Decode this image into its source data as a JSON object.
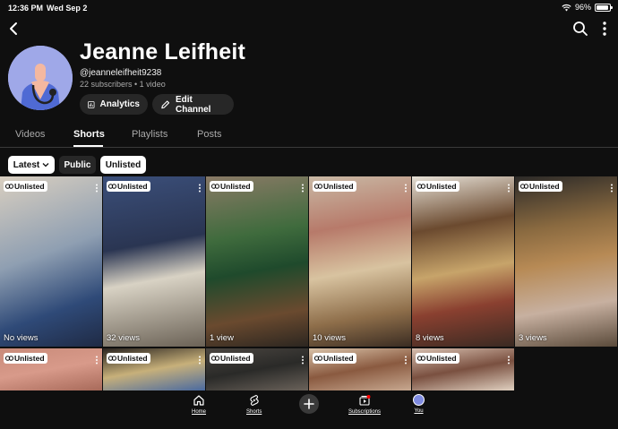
{
  "status_bar": {
    "time": "12:36 PM",
    "date": "Wed Sep 2",
    "battery": "96%",
    "battery_level": 0.96
  },
  "channel": {
    "name": "Jeanne Leifheit",
    "handle": "@jeanneleifheit9238",
    "meta": "22 subscribers • 1 video",
    "analytics_label": "Analytics",
    "edit_label": "Edit Channel"
  },
  "tabs": [
    {
      "label": "Videos"
    },
    {
      "label": "Shorts"
    },
    {
      "label": "Playlists"
    },
    {
      "label": "Posts"
    }
  ],
  "filters": {
    "latest": "Latest",
    "public": "Public",
    "unlisted": "Unlisted"
  },
  "shorts": [
    {
      "badge": "Unlisted",
      "views": "No views"
    },
    {
      "badge": "Unlisted",
      "views": "32 views"
    },
    {
      "badge": "Unlisted",
      "views": "1 view"
    },
    {
      "badge": "Unlisted",
      "views": "10 views"
    },
    {
      "badge": "Unlisted",
      "views": "8 views"
    },
    {
      "badge": "Unlisted",
      "views": "3 views"
    },
    {
      "badge": "Unlisted",
      "views": ""
    },
    {
      "badge": "Unlisted",
      "views": ""
    },
    {
      "badge": "Unlisted",
      "views": ""
    },
    {
      "badge": "Unlisted",
      "views": ""
    },
    {
      "badge": "Unlisted",
      "views": ""
    }
  ],
  "bottom_nav": {
    "home": "Home",
    "shorts": "Shorts",
    "subscriptions": "Subscriptions",
    "you": "You"
  },
  "colors": {
    "background": "#0f0f0f",
    "chip_dark": "#272727",
    "avatar_bg": "#9fa8e8",
    "notification": "#ff0000"
  }
}
